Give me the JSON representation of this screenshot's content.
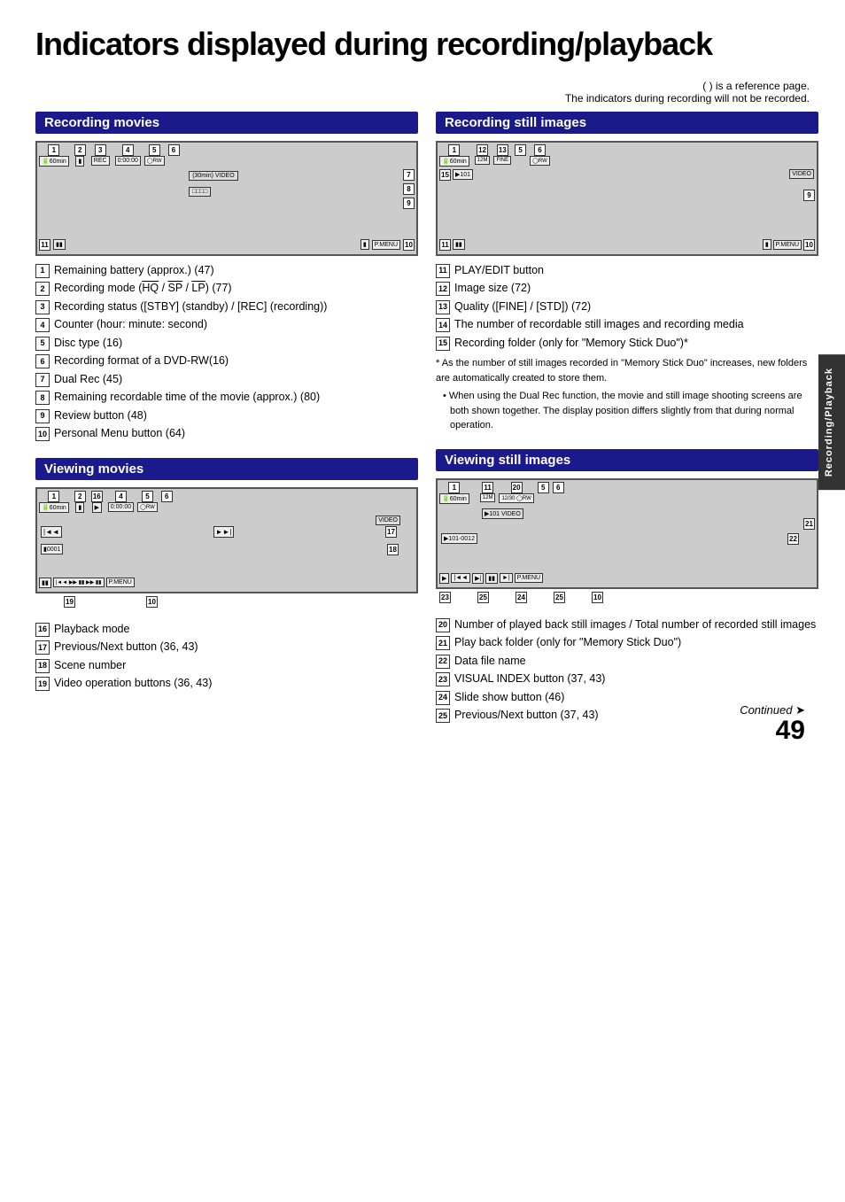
{
  "page": {
    "title": "Indicators displayed during recording/playback",
    "reference_note_1": "( ) is a reference page.",
    "reference_note_2": "The indicators during recording will not be recorded.",
    "page_number": "49",
    "continued_text": "Continued",
    "sidebar_label": "Recording/Playback"
  },
  "sections": {
    "recording_movies": {
      "header": "Recording movies",
      "items": [
        {
          "num": "1",
          "text": "Remaining battery (approx.) (47)"
        },
        {
          "num": "2",
          "text": "Recording mode (HQ / SP / LP) (77)"
        },
        {
          "num": "3",
          "text": "Recording status ([STBY] (standby) / [REC] (recording))"
        },
        {
          "num": "4",
          "text": "Counter (hour: minute: second)"
        },
        {
          "num": "5",
          "text": "Disc type (16)"
        },
        {
          "num": "6",
          "text": "Recording format of a DVD-RW(16)"
        },
        {
          "num": "7",
          "text": "Dual Rec (45)"
        },
        {
          "num": "8",
          "text": "Remaining recordable time of the movie (approx.) (80)"
        },
        {
          "num": "9",
          "text": "Review button (48)"
        },
        {
          "num": "10",
          "text": "Personal Menu button (64)"
        }
      ]
    },
    "recording_still": {
      "header": "Recording still images",
      "items": [
        {
          "num": "11",
          "text": "PLAY/EDIT button"
        },
        {
          "num": "12",
          "text": "Image size (72)"
        },
        {
          "num": "13",
          "text": "Quality ([FINE] / [STD]) (72)"
        },
        {
          "num": "14",
          "text": "The number of recordable still images and recording media"
        },
        {
          "num": "15",
          "text": "Recording folder (only for \"Memory Stick Duo\")*"
        }
      ],
      "notes": [
        {
          "prefix": "*",
          "text": "As the number of still images recorded in \"Memory Stick Duo\" increases, new folders are automatically created to store them."
        },
        {
          "prefix": "•",
          "text": "When using the Dual Rec function, the movie and still image shooting screens are both shown together. The display position differs slightly from that during normal operation."
        }
      ]
    },
    "viewing_movies": {
      "header": "Viewing movies",
      "items": [
        {
          "num": "16",
          "text": "Playback mode"
        },
        {
          "num": "17",
          "text": "Previous/Next button (36, 43)"
        },
        {
          "num": "18",
          "text": "Scene number"
        },
        {
          "num": "19",
          "text": "Video operation buttons (36, 43)"
        }
      ]
    },
    "viewing_still": {
      "header": "Viewing still images",
      "items": [
        {
          "num": "20",
          "text": "Number of played back still images / Total number of recorded still images"
        },
        {
          "num": "21",
          "text": "Play back folder (only for \"Memory Stick Duo\")"
        },
        {
          "num": "22",
          "text": "Data file name"
        },
        {
          "num": "23",
          "text": "VISUAL INDEX button (37, 43)"
        },
        {
          "num": "24",
          "text": "Slide show button (46)"
        },
        {
          "num": "25",
          "text": "Previous/Next button (37, 43)"
        }
      ]
    }
  }
}
